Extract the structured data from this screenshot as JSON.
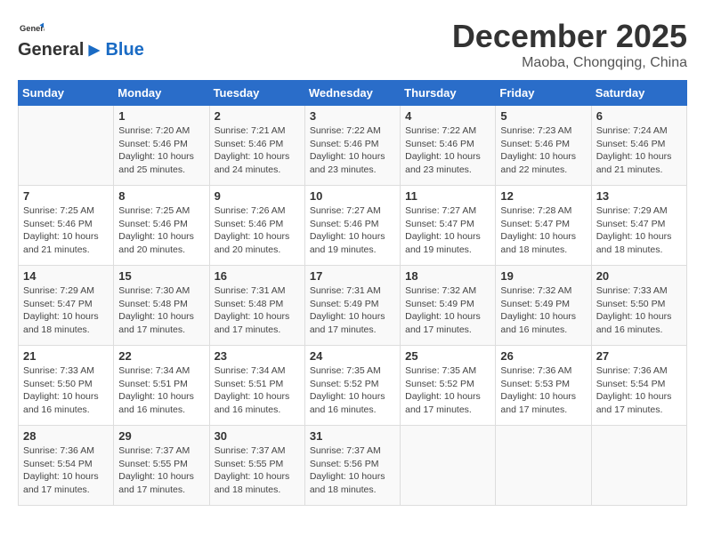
{
  "header": {
    "logo_general": "General",
    "logo_blue": "Blue",
    "title": "December 2025",
    "location": "Maoba, Chongqing, China"
  },
  "days_of_week": [
    "Sunday",
    "Monday",
    "Tuesday",
    "Wednesday",
    "Thursday",
    "Friday",
    "Saturday"
  ],
  "weeks": [
    [
      {
        "day": "",
        "content": ""
      },
      {
        "day": "1",
        "content": "Sunrise: 7:20 AM\nSunset: 5:46 PM\nDaylight: 10 hours\nand 25 minutes."
      },
      {
        "day": "2",
        "content": "Sunrise: 7:21 AM\nSunset: 5:46 PM\nDaylight: 10 hours\nand 24 minutes."
      },
      {
        "day": "3",
        "content": "Sunrise: 7:22 AM\nSunset: 5:46 PM\nDaylight: 10 hours\nand 23 minutes."
      },
      {
        "day": "4",
        "content": "Sunrise: 7:22 AM\nSunset: 5:46 PM\nDaylight: 10 hours\nand 23 minutes."
      },
      {
        "day": "5",
        "content": "Sunrise: 7:23 AM\nSunset: 5:46 PM\nDaylight: 10 hours\nand 22 minutes."
      },
      {
        "day": "6",
        "content": "Sunrise: 7:24 AM\nSunset: 5:46 PM\nDaylight: 10 hours\nand 21 minutes."
      }
    ],
    [
      {
        "day": "7",
        "content": "Sunrise: 7:25 AM\nSunset: 5:46 PM\nDaylight: 10 hours\nand 21 minutes."
      },
      {
        "day": "8",
        "content": "Sunrise: 7:25 AM\nSunset: 5:46 PM\nDaylight: 10 hours\nand 20 minutes."
      },
      {
        "day": "9",
        "content": "Sunrise: 7:26 AM\nSunset: 5:46 PM\nDaylight: 10 hours\nand 20 minutes."
      },
      {
        "day": "10",
        "content": "Sunrise: 7:27 AM\nSunset: 5:46 PM\nDaylight: 10 hours\nand 19 minutes."
      },
      {
        "day": "11",
        "content": "Sunrise: 7:27 AM\nSunset: 5:47 PM\nDaylight: 10 hours\nand 19 minutes."
      },
      {
        "day": "12",
        "content": "Sunrise: 7:28 AM\nSunset: 5:47 PM\nDaylight: 10 hours\nand 18 minutes."
      },
      {
        "day": "13",
        "content": "Sunrise: 7:29 AM\nSunset: 5:47 PM\nDaylight: 10 hours\nand 18 minutes."
      }
    ],
    [
      {
        "day": "14",
        "content": "Sunrise: 7:29 AM\nSunset: 5:47 PM\nDaylight: 10 hours\nand 18 minutes."
      },
      {
        "day": "15",
        "content": "Sunrise: 7:30 AM\nSunset: 5:48 PM\nDaylight: 10 hours\nand 17 minutes."
      },
      {
        "day": "16",
        "content": "Sunrise: 7:31 AM\nSunset: 5:48 PM\nDaylight: 10 hours\nand 17 minutes."
      },
      {
        "day": "17",
        "content": "Sunrise: 7:31 AM\nSunset: 5:49 PM\nDaylight: 10 hours\nand 17 minutes."
      },
      {
        "day": "18",
        "content": "Sunrise: 7:32 AM\nSunset: 5:49 PM\nDaylight: 10 hours\nand 17 minutes."
      },
      {
        "day": "19",
        "content": "Sunrise: 7:32 AM\nSunset: 5:49 PM\nDaylight: 10 hours\nand 16 minutes."
      },
      {
        "day": "20",
        "content": "Sunrise: 7:33 AM\nSunset: 5:50 PM\nDaylight: 10 hours\nand 16 minutes."
      }
    ],
    [
      {
        "day": "21",
        "content": "Sunrise: 7:33 AM\nSunset: 5:50 PM\nDaylight: 10 hours\nand 16 minutes."
      },
      {
        "day": "22",
        "content": "Sunrise: 7:34 AM\nSunset: 5:51 PM\nDaylight: 10 hours\nand 16 minutes."
      },
      {
        "day": "23",
        "content": "Sunrise: 7:34 AM\nSunset: 5:51 PM\nDaylight: 10 hours\nand 16 minutes."
      },
      {
        "day": "24",
        "content": "Sunrise: 7:35 AM\nSunset: 5:52 PM\nDaylight: 10 hours\nand 16 minutes."
      },
      {
        "day": "25",
        "content": "Sunrise: 7:35 AM\nSunset: 5:52 PM\nDaylight: 10 hours\nand 17 minutes."
      },
      {
        "day": "26",
        "content": "Sunrise: 7:36 AM\nSunset: 5:53 PM\nDaylight: 10 hours\nand 17 minutes."
      },
      {
        "day": "27",
        "content": "Sunrise: 7:36 AM\nSunset: 5:54 PM\nDaylight: 10 hours\nand 17 minutes."
      }
    ],
    [
      {
        "day": "28",
        "content": "Sunrise: 7:36 AM\nSunset: 5:54 PM\nDaylight: 10 hours\nand 17 minutes."
      },
      {
        "day": "29",
        "content": "Sunrise: 7:37 AM\nSunset: 5:55 PM\nDaylight: 10 hours\nand 17 minutes."
      },
      {
        "day": "30",
        "content": "Sunrise: 7:37 AM\nSunset: 5:55 PM\nDaylight: 10 hours\nand 18 minutes."
      },
      {
        "day": "31",
        "content": "Sunrise: 7:37 AM\nSunset: 5:56 PM\nDaylight: 10 hours\nand 18 minutes."
      },
      {
        "day": "",
        "content": ""
      },
      {
        "day": "",
        "content": ""
      },
      {
        "day": "",
        "content": ""
      }
    ]
  ]
}
